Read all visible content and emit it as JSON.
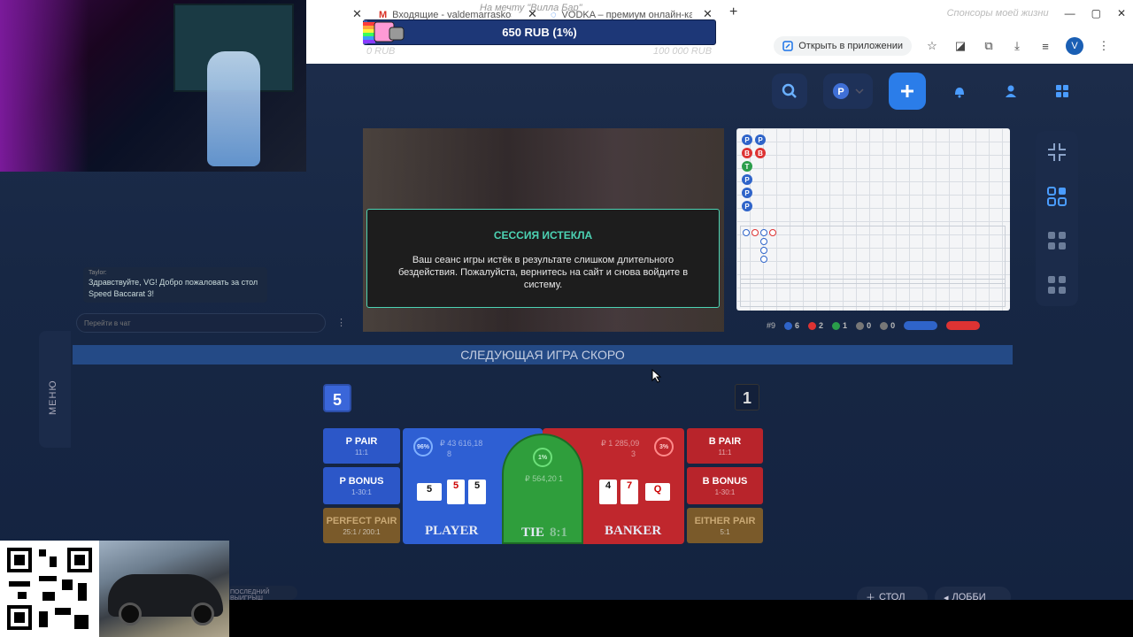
{
  "browser": {
    "tabs": [
      {
        "title": "Входящие - valdemarraskosnyi@gmail.com",
        "icon": "gmail-icon"
      },
      {
        "title": "VODKA – премиум онлайн-казино",
        "icon": "loading-icon"
      }
    ],
    "new_tab": "+",
    "open_in_app": "Открыть в приложении",
    "profile_initial": "V",
    "faded_banner_center": "На мечту \"Вилла Бар\"",
    "faded_banner_right": "Спонсоры моей жизни"
  },
  "donation_bar": {
    "amount_text": "650 RUB (1%)",
    "progress_percent": 1,
    "min_label": "0 RUB",
    "max_label": "100 000 RUB"
  },
  "chat": {
    "author": "Taylor:",
    "message": "Здравствуйте, VG! Добро пожаловать за стол Speed Baccarat 3!",
    "input_placeholder": "Перейти в чат",
    "more": "⋮"
  },
  "menu_tab": "МЕНЮ",
  "modal": {
    "title": "СЕССИЯ ИСТЕКЛА",
    "text": "Ваш сеанс игры истёк в результате слишком длительного бездействия. Пожалуйста, вернитесь на сайт и снова войдите в систему."
  },
  "scoreboard": {
    "beads": [
      {
        "col": 0,
        "row": 0,
        "type": "P"
      },
      {
        "col": 1,
        "row": 0,
        "type": "P"
      },
      {
        "col": 0,
        "row": 1,
        "type": "B"
      },
      {
        "col": 1,
        "row": 1,
        "type": "B"
      },
      {
        "col": 0,
        "row": 2,
        "type": "T"
      },
      {
        "col": 0,
        "row": 3,
        "type": "P"
      },
      {
        "col": 0,
        "row": 4,
        "type": "P"
      },
      {
        "col": 0,
        "row": 5,
        "type": "P"
      }
    ],
    "stats": {
      "rounds": "#9",
      "player": "6",
      "banker": "2",
      "tie": "1",
      "p_pair": "0",
      "b_pair": "0"
    }
  },
  "next_game_banner": "СЛЕДУЮЩАЯ ИГРА СКОРО",
  "counters": {
    "player_score": "5",
    "banker_score": "1"
  },
  "bets": {
    "p_pair": {
      "label": "P PAIR",
      "odds": "11:1"
    },
    "p_bonus": {
      "label": "P BONUS",
      "odds": "1-30:1"
    },
    "perfect_pair": {
      "label": "PERFECT PAIR",
      "odds": "25:1 / 200:1"
    },
    "b_pair": {
      "label": "B PAIR",
      "odds": "11:1"
    },
    "b_bonus": {
      "label": "B BONUS",
      "odds": "1-30:1"
    },
    "either_pair": {
      "label": "EITHER PAIR",
      "odds": "5:1"
    },
    "player": {
      "label": "PLAYER",
      "percent": "96%",
      "amount": "₽ 43 616,18",
      "players": "8",
      "cards": [
        "5",
        "5",
        "5"
      ]
    },
    "tie": {
      "label": "TIE",
      "odds": "8:1",
      "percent": "1%",
      "amount": "₽ 564,20",
      "players": "1"
    },
    "banker": {
      "label": "BANKER",
      "percent": "3%",
      "amount": "₽ 1 285,09",
      "players": "3",
      "cards": [
        "4",
        "7",
        "Q"
      ]
    }
  },
  "bottom": {
    "last_win": "ПОСЛЕДНИЙ ВЫИГРЫШ",
    "stol": "СТОЛ",
    "lobby": "ЛОББИ"
  },
  "colors": {
    "accent": "#2b7de9",
    "player": "#2e5fd3",
    "banker": "#c0272d",
    "tie": "#2f9e3c",
    "modal_accent": "#4cd3b4"
  }
}
